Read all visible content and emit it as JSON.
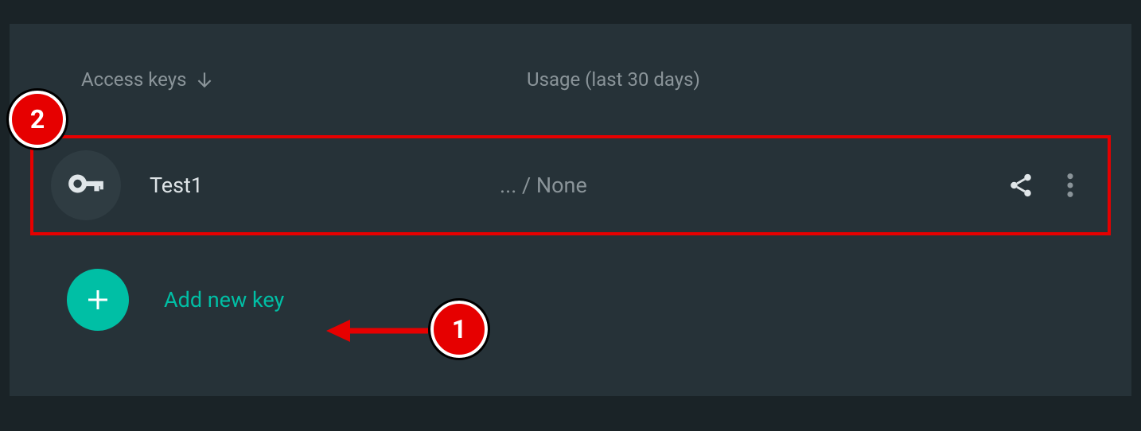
{
  "headers": {
    "access_keys": "Access keys",
    "usage": "Usage (last 30 days)"
  },
  "keys": [
    {
      "name": "Test1",
      "usage": "... / None"
    }
  ],
  "add_key_label": "Add new key",
  "annotations": {
    "marker1": "1",
    "marker2": "2"
  }
}
